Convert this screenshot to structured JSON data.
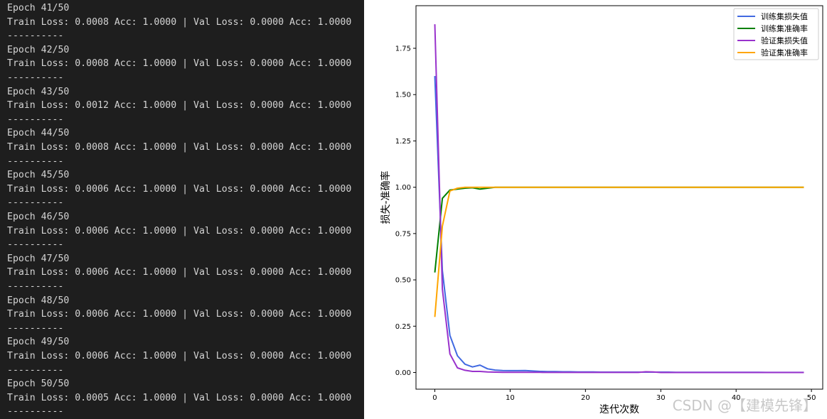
{
  "console": {
    "lines": [
      "Epoch 41/50",
      "Train Loss: 0.0008 Acc: 1.0000 | Val Loss: 0.0000 Acc: 1.0000",
      "----------",
      "Epoch 42/50",
      "Train Loss: 0.0008 Acc: 1.0000 | Val Loss: 0.0000 Acc: 1.0000",
      "----------",
      "Epoch 43/50",
      "Train Loss: 0.0012 Acc: 1.0000 | Val Loss: 0.0000 Acc: 1.0000",
      "----------",
      "Epoch 44/50",
      "Train Loss: 0.0008 Acc: 1.0000 | Val Loss: 0.0000 Acc: 1.0000",
      "----------",
      "Epoch 45/50",
      "Train Loss: 0.0006 Acc: 1.0000 | Val Loss: 0.0000 Acc: 1.0000",
      "----------",
      "Epoch 46/50",
      "Train Loss: 0.0006 Acc: 1.0000 | Val Loss: 0.0000 Acc: 1.0000",
      "----------",
      "Epoch 47/50",
      "Train Loss: 0.0006 Acc: 1.0000 | Val Loss: 0.0000 Acc: 1.0000",
      "----------",
      "Epoch 48/50",
      "Train Loss: 0.0006 Acc: 1.0000 | Val Loss: 0.0000 Acc: 1.0000",
      "----------",
      "Epoch 49/50",
      "Train Loss: 0.0006 Acc: 1.0000 | Val Loss: 0.0000 Acc: 1.0000",
      "----------",
      "Epoch 50/50",
      "Train Loss: 0.0005 Acc: 1.0000 | Val Loss: 0.0000 Acc: 1.0000",
      "----------"
    ]
  },
  "watermark": "CSDN @【建模先锋】",
  "chart_data": {
    "type": "line",
    "xlabel": "迭代次数",
    "ylabel": "损失-准确率",
    "xlim": [
      -2.5,
      51.5
    ],
    "ylim": [
      -0.09,
      1.98
    ],
    "xticks": [
      0,
      10,
      20,
      30,
      40,
      50
    ],
    "yticks": [
      0.0,
      0.25,
      0.5,
      0.75,
      1.0,
      1.25,
      1.5,
      1.75
    ],
    "ytick_labels": [
      "0.00",
      "0.25",
      "0.50",
      "0.75",
      "1.00",
      "1.25",
      "1.50",
      "1.75"
    ],
    "grid": false,
    "legend": "top-right",
    "series": [
      {
        "name": "训练集损失值",
        "color": "#4169e1",
        "x": [
          0,
          1,
          2,
          3,
          4,
          5,
          6,
          7,
          8,
          9,
          10,
          11,
          12,
          13,
          14,
          15,
          16,
          17,
          18,
          19,
          20,
          21,
          22,
          23,
          24,
          25,
          26,
          27,
          28,
          29,
          30,
          31,
          32,
          33,
          34,
          35,
          36,
          37,
          38,
          39,
          40,
          41,
          42,
          43,
          44,
          45,
          46,
          47,
          48,
          49
        ],
        "y": [
          1.6,
          0.55,
          0.2,
          0.09,
          0.045,
          0.03,
          0.04,
          0.02,
          0.013,
          0.011,
          0.01,
          0.01,
          0.011,
          0.008,
          0.006,
          0.005,
          0.005,
          0.004,
          0.004,
          0.003,
          0.003,
          0.003,
          0.002,
          0.002,
          0.002,
          0.002,
          0.002,
          0.002,
          0.002,
          0.002,
          0.002,
          0.002,
          0.001,
          0.001,
          0.001,
          0.001,
          0.001,
          0.001,
          0.001,
          0.001,
          0.0008,
          0.0008,
          0.0012,
          0.0008,
          0.0006,
          0.0006,
          0.0006,
          0.0006,
          0.0006,
          0.0005
        ]
      },
      {
        "name": "训练集准确率",
        "color": "#008000",
        "x": [
          0,
          1,
          2,
          3,
          4,
          5,
          6,
          7,
          8,
          9,
          10,
          11,
          12,
          13,
          14,
          15,
          16,
          17,
          18,
          19,
          20,
          21,
          22,
          23,
          24,
          25,
          26,
          27,
          28,
          29,
          30,
          31,
          32,
          33,
          34,
          35,
          36,
          37,
          38,
          39,
          40,
          41,
          42,
          43,
          44,
          45,
          46,
          47,
          48,
          49
        ],
        "y": [
          0.54,
          0.94,
          0.985,
          0.99,
          0.995,
          0.997,
          0.99,
          0.995,
          1.0,
          1.0,
          1.0,
          1.0,
          1.0,
          1.0,
          1.0,
          1.0,
          1.0,
          1.0,
          1.0,
          1.0,
          1.0,
          1.0,
          1.0,
          1.0,
          1.0,
          1.0,
          1.0,
          1.0,
          1.0,
          1.0,
          1.0,
          1.0,
          1.0,
          1.0,
          1.0,
          1.0,
          1.0,
          1.0,
          1.0,
          1.0,
          1.0,
          1.0,
          1.0,
          1.0,
          1.0,
          1.0,
          1.0,
          1.0,
          1.0,
          1.0
        ]
      },
      {
        "name": "验证集损失值",
        "color": "#9932cc",
        "x": [
          0,
          1,
          2,
          3,
          4,
          5,
          6,
          7,
          8,
          9,
          10,
          11,
          12,
          13,
          14,
          15,
          16,
          17,
          18,
          19,
          20,
          21,
          22,
          23,
          24,
          25,
          26,
          27,
          28,
          29,
          30,
          31,
          32,
          33,
          34,
          35,
          36,
          37,
          38,
          39,
          40,
          41,
          42,
          43,
          44,
          45,
          46,
          47,
          48,
          49
        ],
        "y": [
          1.88,
          0.45,
          0.1,
          0.025,
          0.012,
          0.006,
          0.006,
          0.003,
          0.002,
          0.001,
          0.001,
          0.001,
          0.001,
          0.001,
          0.001,
          0.0005,
          0.0005,
          0.0005,
          0.0005,
          0.0005,
          0.0003,
          0.0003,
          0.0003,
          0.0003,
          0.0003,
          0.0003,
          0.0003,
          0.0003,
          0.004,
          0.003,
          0.0002,
          0.0002,
          0.0002,
          0.0001,
          0.0001,
          0.0001,
          0.0001,
          0.0001,
          0.0001,
          0.0001,
          0.0,
          0.0,
          0.0,
          0.0,
          0.0,
          0.0,
          0.0,
          0.0,
          0.0,
          0.0
        ]
      },
      {
        "name": "验证集准确率",
        "color": "#ffa500",
        "x": [
          0,
          1,
          2,
          3,
          4,
          5,
          6,
          7,
          8,
          9,
          10,
          11,
          12,
          13,
          14,
          15,
          16,
          17,
          18,
          19,
          20,
          21,
          22,
          23,
          24,
          25,
          26,
          27,
          28,
          29,
          30,
          31,
          32,
          33,
          34,
          35,
          36,
          37,
          38,
          39,
          40,
          41,
          42,
          43,
          44,
          45,
          46,
          47,
          48,
          49
        ],
        "y": [
          0.3,
          0.79,
          0.98,
          0.995,
          1.0,
          1.0,
          1.0,
          1.0,
          1.0,
          1.0,
          1.0,
          1.0,
          1.0,
          1.0,
          1.0,
          1.0,
          1.0,
          1.0,
          1.0,
          1.0,
          1.0,
          1.0,
          1.0,
          1.0,
          1.0,
          1.0,
          1.0,
          1.0,
          1.0,
          1.0,
          1.0,
          1.0,
          1.0,
          1.0,
          1.0,
          1.0,
          1.0,
          1.0,
          1.0,
          1.0,
          1.0,
          1.0,
          1.0,
          1.0,
          1.0,
          1.0,
          1.0,
          1.0,
          1.0,
          1.0
        ]
      }
    ]
  }
}
